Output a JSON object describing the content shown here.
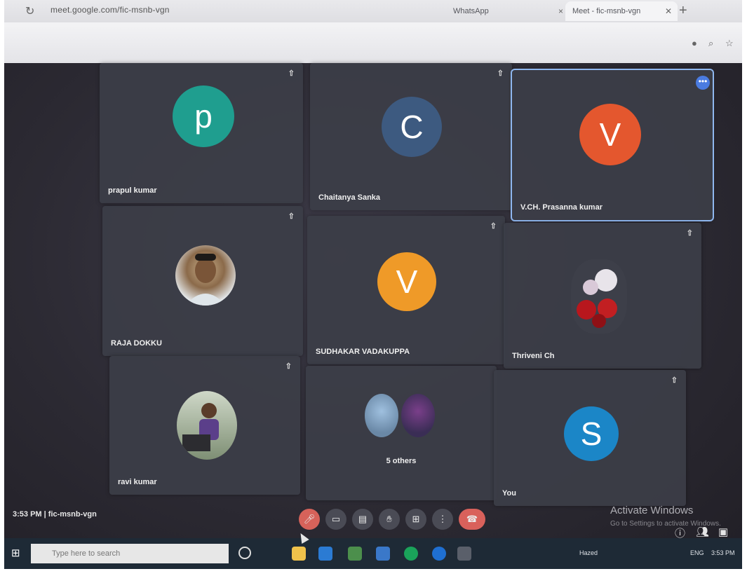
{
  "browser": {
    "tabs": [
      {
        "title": "WhatsApp",
        "close": "×"
      },
      {
        "title": "Meet - fic-msnb-vgn",
        "close": "✕"
      }
    ],
    "new_tab": "+",
    "reload": "↻",
    "url": "meet.google.com/fic-msnb-vgn"
  },
  "participants": [
    {
      "name": "prapul kumar",
      "initial": "p",
      "color": "#1f9e8f",
      "type": "initial"
    },
    {
      "name": "Chaitanya Sanka",
      "initial": "C",
      "color": "#3d5a80",
      "type": "initial"
    },
    {
      "name": "V.CH. Prasanna kumar",
      "initial": "V",
      "color": "#e4572e",
      "type": "initial",
      "active": true
    },
    {
      "name": "RAJA DOKKU",
      "type": "photo"
    },
    {
      "name": "SUDHAKAR VADAKUPPA",
      "initial": "V",
      "color": "#ef9a28",
      "type": "initial"
    },
    {
      "name": "Thriveni Ch",
      "type": "photo"
    },
    {
      "name": "ravi kumar",
      "type": "photo"
    },
    {
      "name": "",
      "caption": "5 others",
      "type": "group"
    },
    {
      "name": "You",
      "initial": "S",
      "color": "#1b86c7",
      "type": "initial"
    }
  ],
  "pin_glyph": "⇧",
  "more_glyph": "•••",
  "meeting_bar": {
    "time": "3:53 PM",
    "separator": "|",
    "code": "fic-msnb-vgn",
    "controls": [
      "mic-off",
      "camera",
      "captions",
      "raise-hand",
      "present",
      "more",
      "end-call"
    ]
  },
  "watermark": {
    "title": "Activate Windows",
    "subtitle": "Go to Settings to activate Windows."
  },
  "taskbar": {
    "search_placeholder": "Type here to search",
    "language": "ENG",
    "clock": "3:53 PM",
    "weather": "Hazed"
  }
}
